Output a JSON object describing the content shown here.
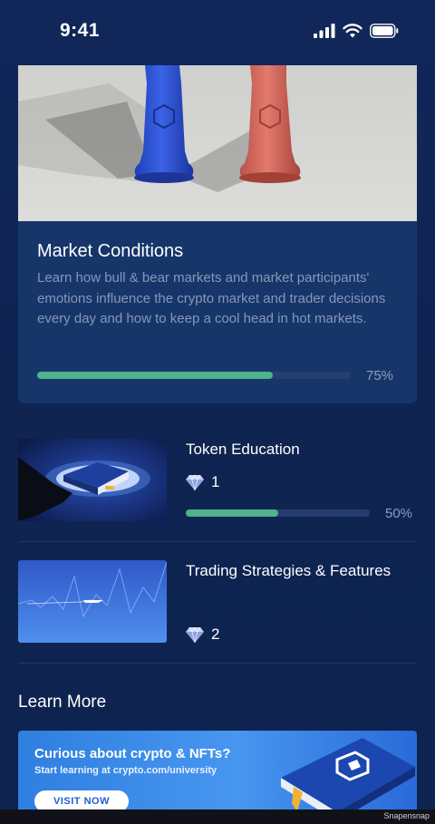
{
  "status_bar": {
    "time": "9:41"
  },
  "featured": {
    "title": "Market Conditions",
    "description": "Learn how bull & bear markets and market participants' emotions influence the crypto market and trader decisions every day and how to keep a cool head in hot markets.",
    "progress": 0.75,
    "progress_label": "75%"
  },
  "courses": [
    {
      "title": "Token Education",
      "gems": "1",
      "progress": 0.5,
      "progress_label": "50%"
    },
    {
      "title": "Trading Strategies & Features",
      "gems": "2"
    }
  ],
  "learn_more": {
    "heading": "Learn More",
    "banner": {
      "headline": "Curious about crypto & NFTs?",
      "subline": "Start learning at crypto.com/university",
      "button": "VISIT NOW"
    }
  },
  "watermark": "Snapensnap",
  "colors": {
    "progress_fill": "#4fb38b",
    "background": "#0f2451",
    "card": "#16366a"
  }
}
